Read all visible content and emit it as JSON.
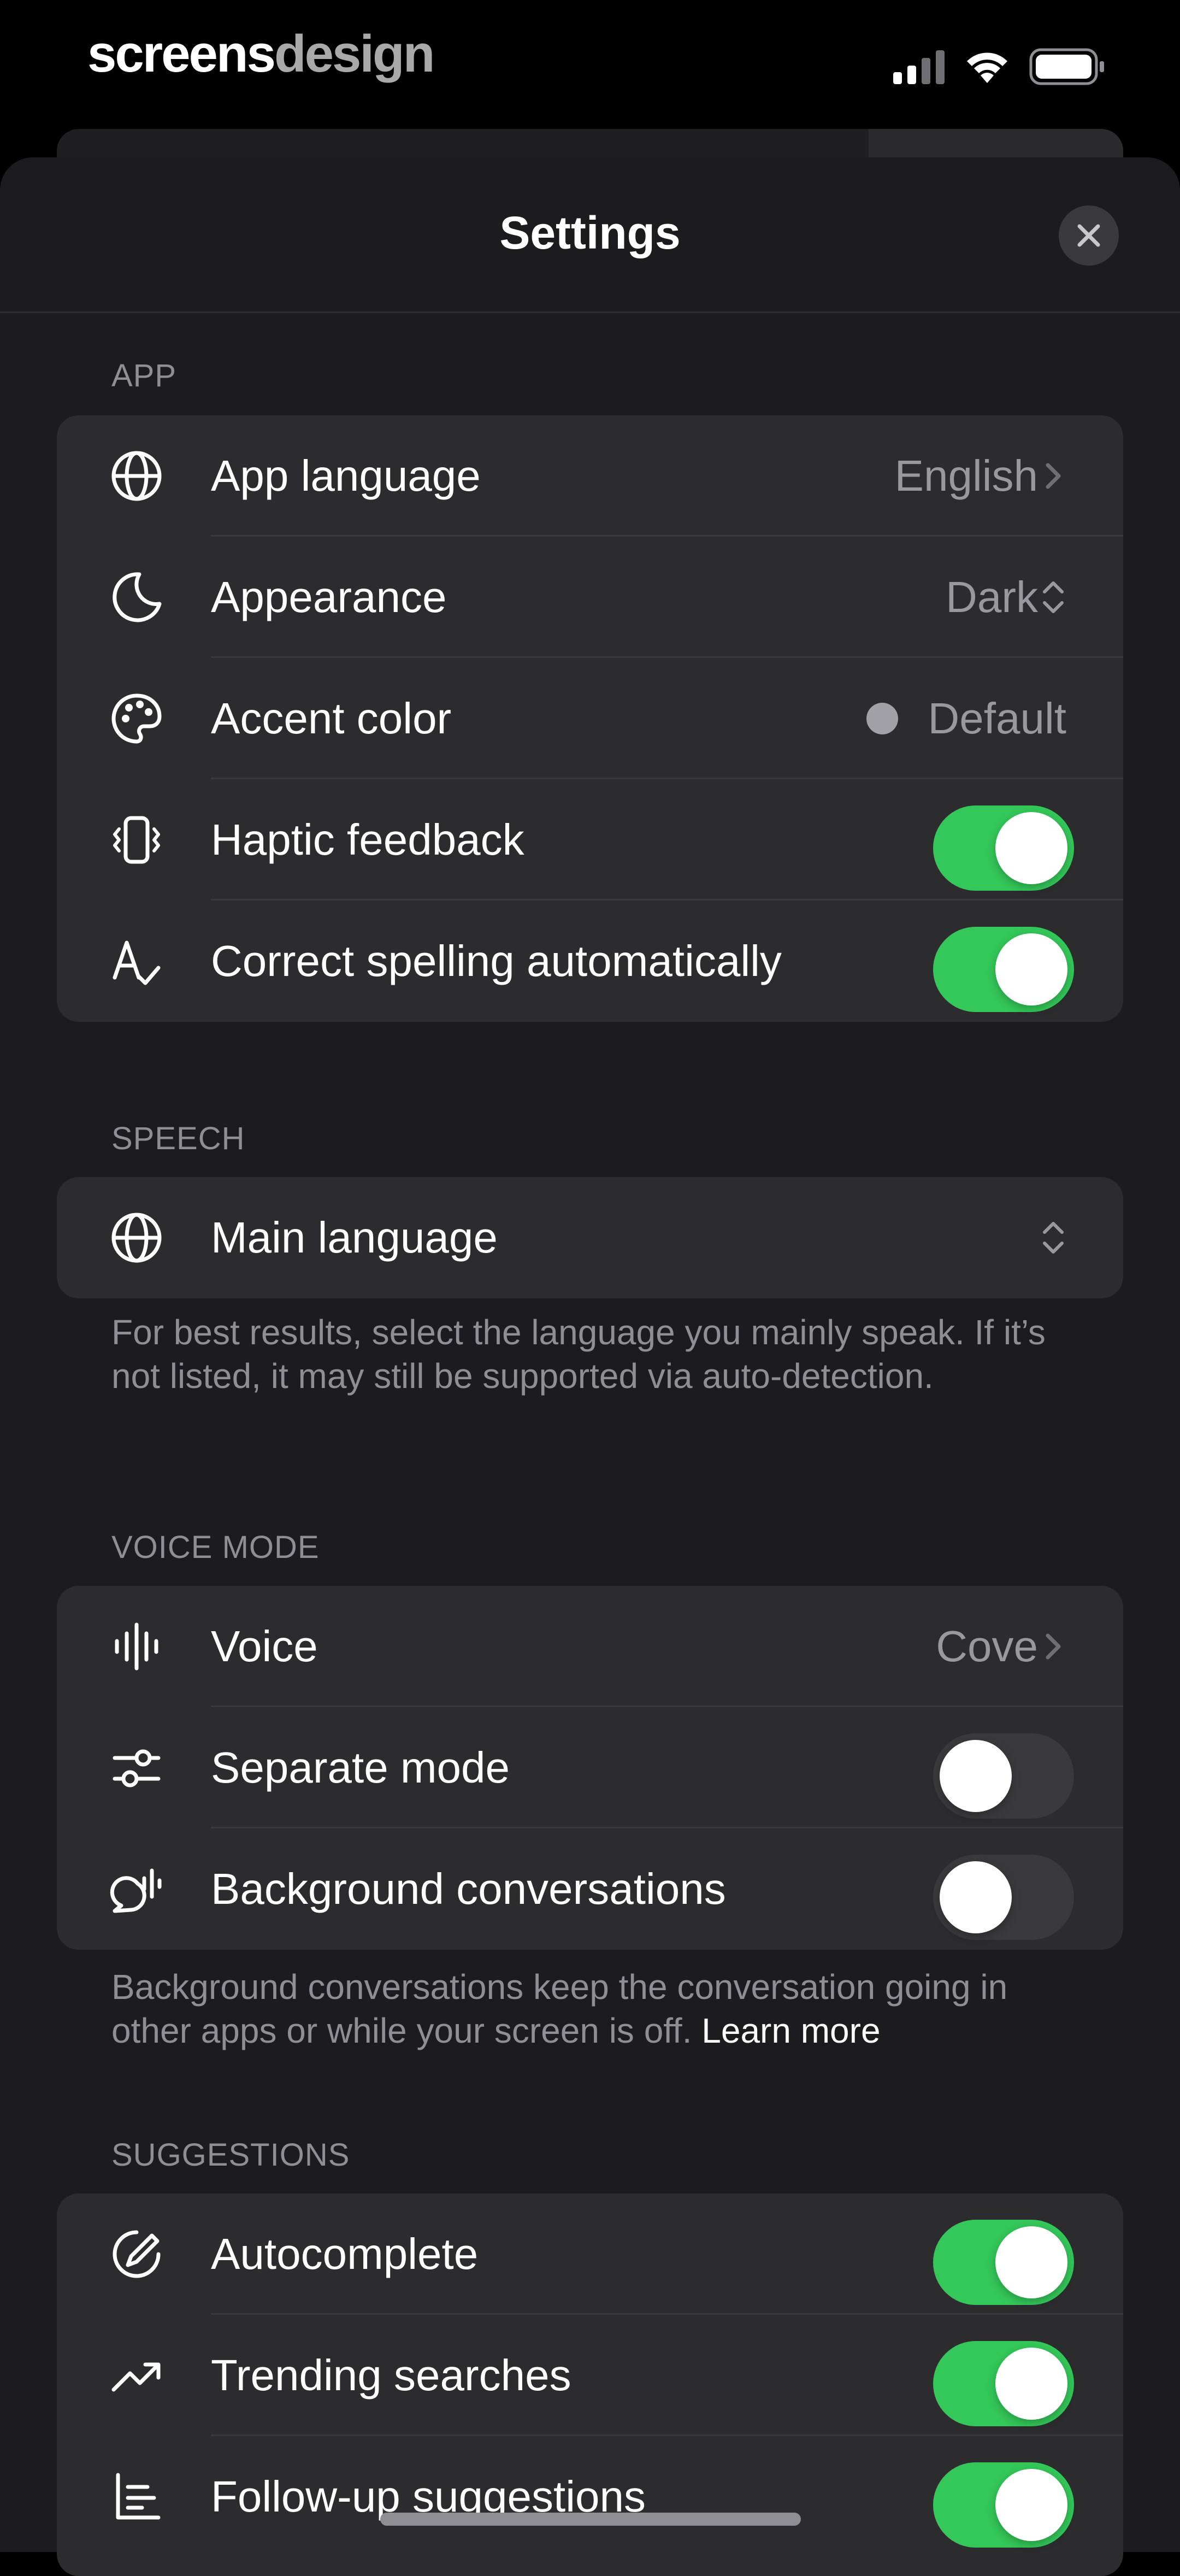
{
  "status_bar": {
    "brand_part1": "screens",
    "brand_part2": "design"
  },
  "sheet": {
    "title": "Settings",
    "close_icon": "xmark-icon"
  },
  "sections": {
    "app": {
      "label": "APP",
      "rows": {
        "app_language": {
          "label": "App language",
          "value": "English",
          "icon": "globe-icon"
        },
        "appearance": {
          "label": "Appearance",
          "value": "Dark",
          "icon": "moon-icon"
        },
        "accent_color": {
          "label": "Accent color",
          "value": "Default",
          "icon": "palette-icon"
        },
        "haptic_feedback": {
          "label": "Haptic feedback",
          "on": true,
          "icon": "haptic-icon"
        },
        "correct_spelling": {
          "label": "Correct spelling automatically",
          "on": true,
          "icon": "spellcheck-icon"
        }
      }
    },
    "speech": {
      "label": "SPEECH",
      "rows": {
        "main_language": {
          "label": "Main language",
          "icon": "globe-icon"
        }
      },
      "footnote": "For best results, select the language you mainly speak. If it’s not listed, it may still be supported via auto-detection."
    },
    "voice_mode": {
      "label": "VOICE MODE",
      "rows": {
        "voice": {
          "label": "Voice",
          "value": "Cove",
          "icon": "waveform-icon"
        },
        "separate_mode": {
          "label": "Separate mode",
          "on": false,
          "icon": "sliders-icon"
        },
        "background_conversations": {
          "label": "Background conversations",
          "on": false,
          "icon": "background-chat-icon"
        }
      },
      "footnote": "Background conversations keep the conversation going in other apps or while your screen is off.",
      "footnote_link": "Learn more"
    },
    "suggestions": {
      "label": "SUGGESTIONS",
      "rows": {
        "autocomplete": {
          "label": "Autocomplete",
          "on": true,
          "icon": "autocomplete-icon"
        },
        "trending_searches": {
          "label": "Trending searches",
          "on": true,
          "icon": "trending-icon"
        },
        "follow_up": {
          "label": "Follow-up suggestions",
          "on": true,
          "icon": "follow-up-icon"
        }
      }
    }
  },
  "colors": {
    "toggle_on": "#34c759",
    "toggle_off": "#3a3a3c",
    "sheet_bg": "#1c1c1e",
    "group_bg": "#2c2c2e"
  }
}
